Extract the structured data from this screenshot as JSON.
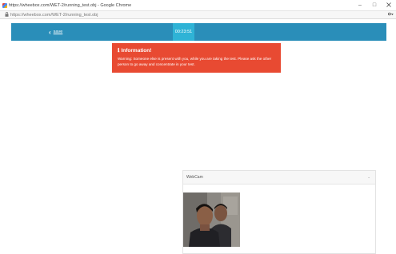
{
  "browser": {
    "window_title": "https://wheebox.com/WET-2/running_test.obj - Google Chrome",
    "url": "https://wheebox.com/WET-2/running_test.obj",
    "minimize": "–",
    "maximize": "□"
  },
  "appbar": {
    "back_label": "save",
    "back_chevron": "‹",
    "timer": "00:23:51"
  },
  "alert": {
    "icon": "ℹ",
    "title": "Information!",
    "message": "Warning: Someone else is present with you, while you are taking the test. Please ask the other person to go away and concentrate in your test."
  },
  "webcam": {
    "title": "WebCam",
    "collapse_glyph": "⌄"
  },
  "colors": {
    "appbar": "#2a8eb9",
    "timer_bg": "#2fb3d6",
    "alert_bg": "#e84a32"
  }
}
